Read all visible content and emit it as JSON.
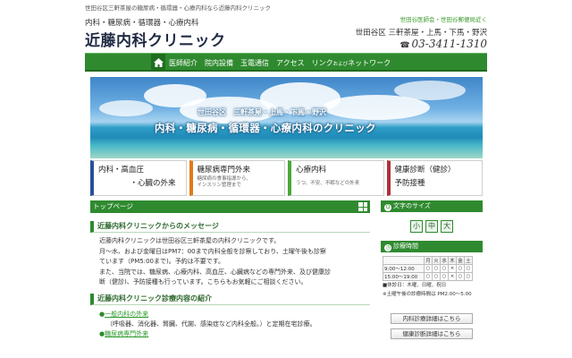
{
  "header": {
    "topbar": "世田谷区三軒茶屋の糖尿病・循環器・心療内科なら近藤内科クリニック",
    "tagline": "内科・糖尿病・循環器・心療内科",
    "logo": "近藤内科クリニック",
    "badge": "世田谷医師会・世田谷郵便局近く",
    "area": "世田谷区 三軒茶屋・上馬・下馬・野沢",
    "phone": "03-3411-1310"
  },
  "nav": {
    "items": [
      {
        "label": "医師紹介"
      },
      {
        "label": "院内設備"
      },
      {
        "label": "玉電通信"
      },
      {
        "label": "アクセス"
      },
      {
        "label": "リンク",
        "small": "および",
        "suffix": "ネットワーク"
      }
    ]
  },
  "hero": {
    "sub": "世田谷区　三軒茶屋・上馬・下馬・野沢",
    "main": "内科・糖尿病・循環器・心療内科のクリニック"
  },
  "feature_buttons": [
    {
      "title": "内科・高血圧",
      "title2": "・心臓の外来",
      "desc": ""
    },
    {
      "title": "糖尿病専門外来",
      "desc": "糖尿病の食事指導から、",
      "desc2": "インスリン管理まで"
    },
    {
      "title": "心療内科",
      "desc": "うつ、不安、不眠などの外来",
      "desc2": ""
    },
    {
      "title": "健康診断（健診）",
      "title2": "予防接種",
      "desc": ""
    }
  ],
  "main": {
    "section_title": "トップページ",
    "message_heading": "近藤内科クリニックからのメッセージ",
    "message_lines": [
      "近藤内科クリニックは世田谷区三軒茶屋の内科クリニックです。",
      "月～水、および金曜日はPM7：00まで内科全般を診察しており、土曜午後も診察",
      "ています（PM5:00まで)。予約は不要です。",
      "また、当院では、糖尿病、心療内科、高血圧、心臓病などの専門外来、及び健康診",
      "断（健診)、予防接種も行っています。こちらもお気軽にご相談ください。"
    ],
    "services_heading": "近藤内科クリニック診療内容の紹介",
    "service_link": "一般内科の外来",
    "service_desc": "（呼吸器、消化器、腎臓、代謝、感染症など内科全般。）と定期在宅診療。",
    "service_link2": "糖尿病専門外来"
  },
  "sidebar": {
    "font_size_title": "文字のサイズ",
    "font_sizes": [
      "小",
      "中",
      "大"
    ],
    "hours_title": "診療時間",
    "days": [
      "月",
      "火",
      "水",
      "木",
      "金",
      "土"
    ],
    "hours": [
      {
        "time": "9:00～12:00",
        "marks": [
          "○",
          "○",
          "○",
          "×",
          "○",
          "○"
        ]
      },
      {
        "time": "15:00～19:00",
        "marks": [
          "○",
          "○",
          "○",
          "×",
          "○",
          "○"
        ]
      }
    ],
    "note1": "■休診日：木曜、日曜、祝日",
    "note2": "※土曜午後の診療時間は PM2:00～5:00",
    "btn1": "内科診療詳細はこちら",
    "btn2": "健康診断詳細はこちら"
  },
  "colors": {
    "accent_green": "#2f8a2f",
    "navy": "#1f2a44",
    "orange": "#e07b1a",
    "red": "#b0323a",
    "blue": "#2a4f9a"
  }
}
